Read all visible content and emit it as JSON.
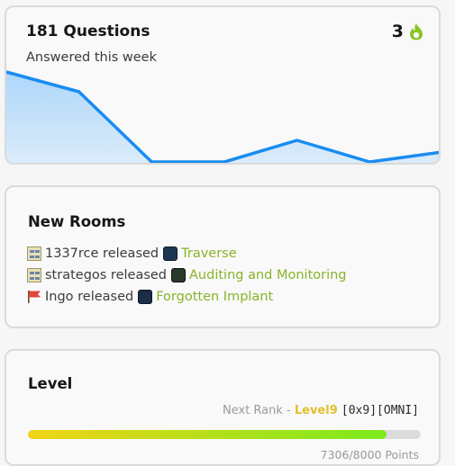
{
  "questions_card": {
    "title": "181 Questions",
    "subtitle": "Answered this week",
    "streak_count": "3",
    "streak_icon": "flame-icon",
    "streak_color": "#86c425",
    "sparkline": {
      "values": [
        100,
        78,
        0,
        0,
        24,
        0,
        11
      ],
      "line_color": "#1a8cf0",
      "fill_color": "#a9d5fb"
    }
  },
  "rooms_card": {
    "title": "New Rooms",
    "items": [
      {
        "user_icon": "user-badge-icon",
        "text": "1337rce released",
        "room_icon": "room-thumbnail-icon",
        "room": "Traverse"
      },
      {
        "user_icon": "user-badge-icon",
        "text": "strategos released",
        "room_icon": "room-thumbnail-icon",
        "room": "Auditing and Monitoring"
      },
      {
        "user_icon": "flag-icon",
        "text": "Ingo released",
        "room_icon": "room-thumbnail-icon",
        "room": "Forgotten Implant"
      }
    ],
    "link_color": "#88b329"
  },
  "level_card": {
    "title": "Level",
    "next_rank_prefix": "Next Rank - ",
    "next_rank_level": "Level9",
    "next_rank_tag": "[0x9][OMNI]",
    "progress_fraction": 0.9133,
    "points_text": "7306/8000 Points"
  }
}
